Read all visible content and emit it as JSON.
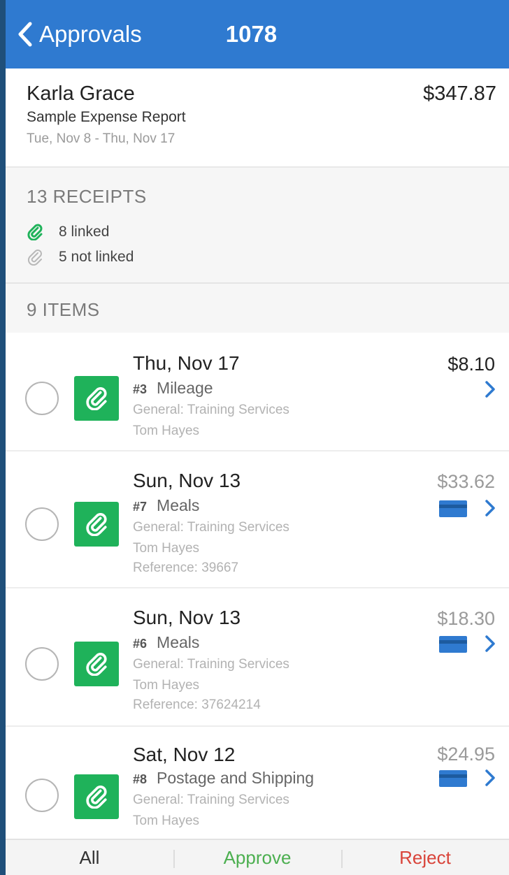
{
  "nav": {
    "back_label": "Approvals",
    "title": "1078"
  },
  "report": {
    "submitter": "Karla Grace",
    "total": "$347.87",
    "name": "Sample Expense Report",
    "dates": "Tue, Nov 8 - Thu, Nov 17"
  },
  "receipts": {
    "title": "13 RECEIPTS",
    "linked": "8 linked",
    "not_linked": "5 not linked"
  },
  "items_title": "9 ITEMS",
  "items": [
    {
      "date": "Thu, Nov 17",
      "num": "#3",
      "type": "Mileage",
      "category": "General: Training Services",
      "person": "Tom Hayes",
      "reference": "",
      "amount": "$8.10",
      "has_card": false
    },
    {
      "date": "Sun, Nov 13",
      "num": "#7",
      "type": "Meals",
      "category": "General: Training Services",
      "person": "Tom Hayes",
      "reference": "Reference: 39667",
      "amount": "$33.62",
      "has_card": true
    },
    {
      "date": "Sun, Nov 13",
      "num": "#6",
      "type": "Meals",
      "category": "General: Training Services",
      "person": "Tom Hayes",
      "reference": "Reference: 37624214",
      "amount": "$18.30",
      "has_card": true
    },
    {
      "date": "Sat, Nov 12",
      "num": "#8",
      "type": "Postage and Shipping",
      "category": "General: Training Services",
      "person": "Tom Hayes",
      "reference": "",
      "amount": "$24.95",
      "has_card": true
    }
  ],
  "tabs": {
    "all": "All",
    "approve": "Approve",
    "reject": "Reject"
  },
  "colors": {
    "nav_blue": "#2f7ad0",
    "linked_green": "#1fb25a",
    "approve_green": "#4caf50",
    "reject_red": "#d9443a"
  }
}
